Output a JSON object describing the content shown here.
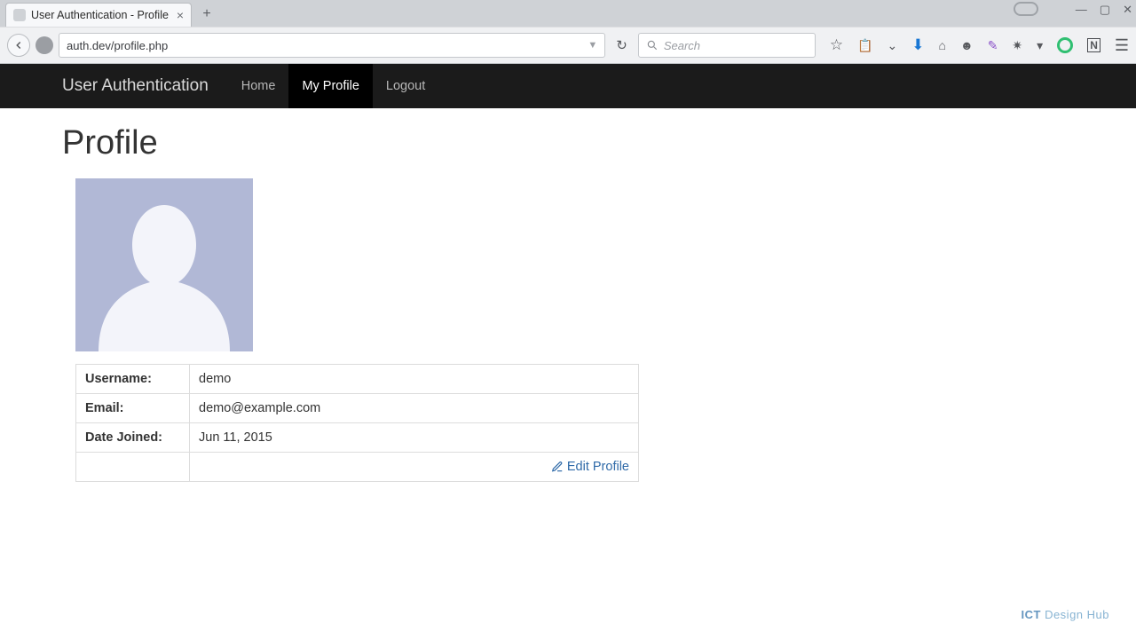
{
  "browser": {
    "tab_title": "User Authentication - Profile",
    "url": "auth.dev/profile.php",
    "search_placeholder": "Search"
  },
  "navbar": {
    "brand": "User Authentication",
    "items": [
      {
        "label": "Home",
        "active": false
      },
      {
        "label": "My Profile",
        "active": true
      },
      {
        "label": "Logout",
        "active": false
      }
    ]
  },
  "page": {
    "title": "Profile",
    "fields": {
      "username_label": "Username:",
      "username_value": "demo",
      "email_label": "Email:",
      "email_value": "demo@example.com",
      "joined_label": "Date Joined:",
      "joined_value": "Jun 11, 2015"
    },
    "edit_link": "Edit Profile"
  },
  "watermark": "ICT Design Hub"
}
